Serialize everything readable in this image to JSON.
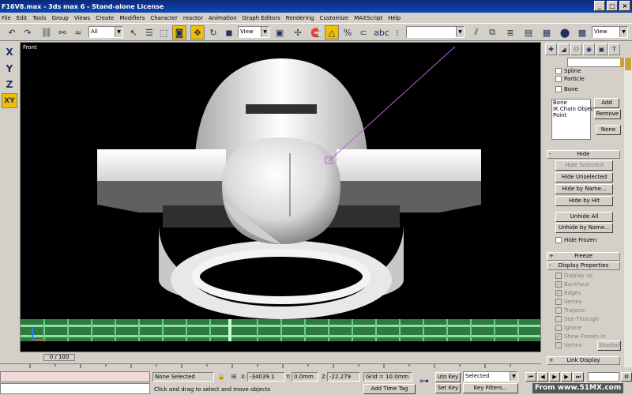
{
  "window": {
    "title": "F16V8.max - 3ds max 6 - Stand-alone License"
  },
  "menu": [
    "File",
    "Edit",
    "Tools",
    "Group",
    "Views",
    "Create",
    "Modifiers",
    "Character",
    "reactor",
    "Animation",
    "Graph Editors",
    "Rendering",
    "Customize",
    "MAXScript",
    "Help"
  ],
  "toolbar": {
    "selection_filter": "All",
    "ref_coord": "View",
    "named_selection": "",
    "view_dropdown": "View"
  },
  "axis": {
    "x": "X",
    "y": "Y",
    "z": "Z",
    "xy": "XY"
  },
  "viewport": {
    "label": "Front"
  },
  "panel": {
    "spline": "Spline",
    "particle": "Particle",
    "bone": "Bone",
    "list": [
      "Bone",
      "IK Chain Object",
      "Point"
    ],
    "add": "Add",
    "remove": "Remove",
    "none": "None",
    "hide_rollout": "Hide",
    "hide_selected": "Hide Selected",
    "hide_unselected": "Hide Unselected",
    "hide_by_name": "Hide by Name...",
    "hide_by_hit": "Hide by Hit",
    "unhide_all": "Unhide All",
    "unhide_by_name": "Unhide by Name...",
    "hide_frozen": "Hide Frozen",
    "freeze_rollout": "Freeze",
    "display_props_rollout": "Display Properties",
    "display_as": "Display as",
    "backface": "Backface",
    "edges": "Edges",
    "vertex_ticks": "Vertex",
    "trajectory": "Trajectc",
    "see_through": "See-Through",
    "ignore": "Ignore",
    "show_frozen": "Show Frozen in",
    "vertex_colors": "Vertex",
    "shaded": "Shaded",
    "link_display_rollout": "Link Display"
  },
  "timeslider": {
    "frame": "0 / 100"
  },
  "status": {
    "selection": "None Selected",
    "x_label": "X:",
    "x_value": "-34039.1",
    "y_label": "Y:",
    "y_value": "0.0mm",
    "z_label": "Z:",
    "z_value": "-22.279",
    "grid": "Grid = 10.0mm",
    "auto_key": "uto Key",
    "key_mode": "Selected",
    "set_key": "Set Key",
    "key_filters": "Key Filters...",
    "prompt": "Click and drag to select and move objects",
    "add_time_tag": "Add Time Tag"
  },
  "watermark": "From www.51MX.com"
}
